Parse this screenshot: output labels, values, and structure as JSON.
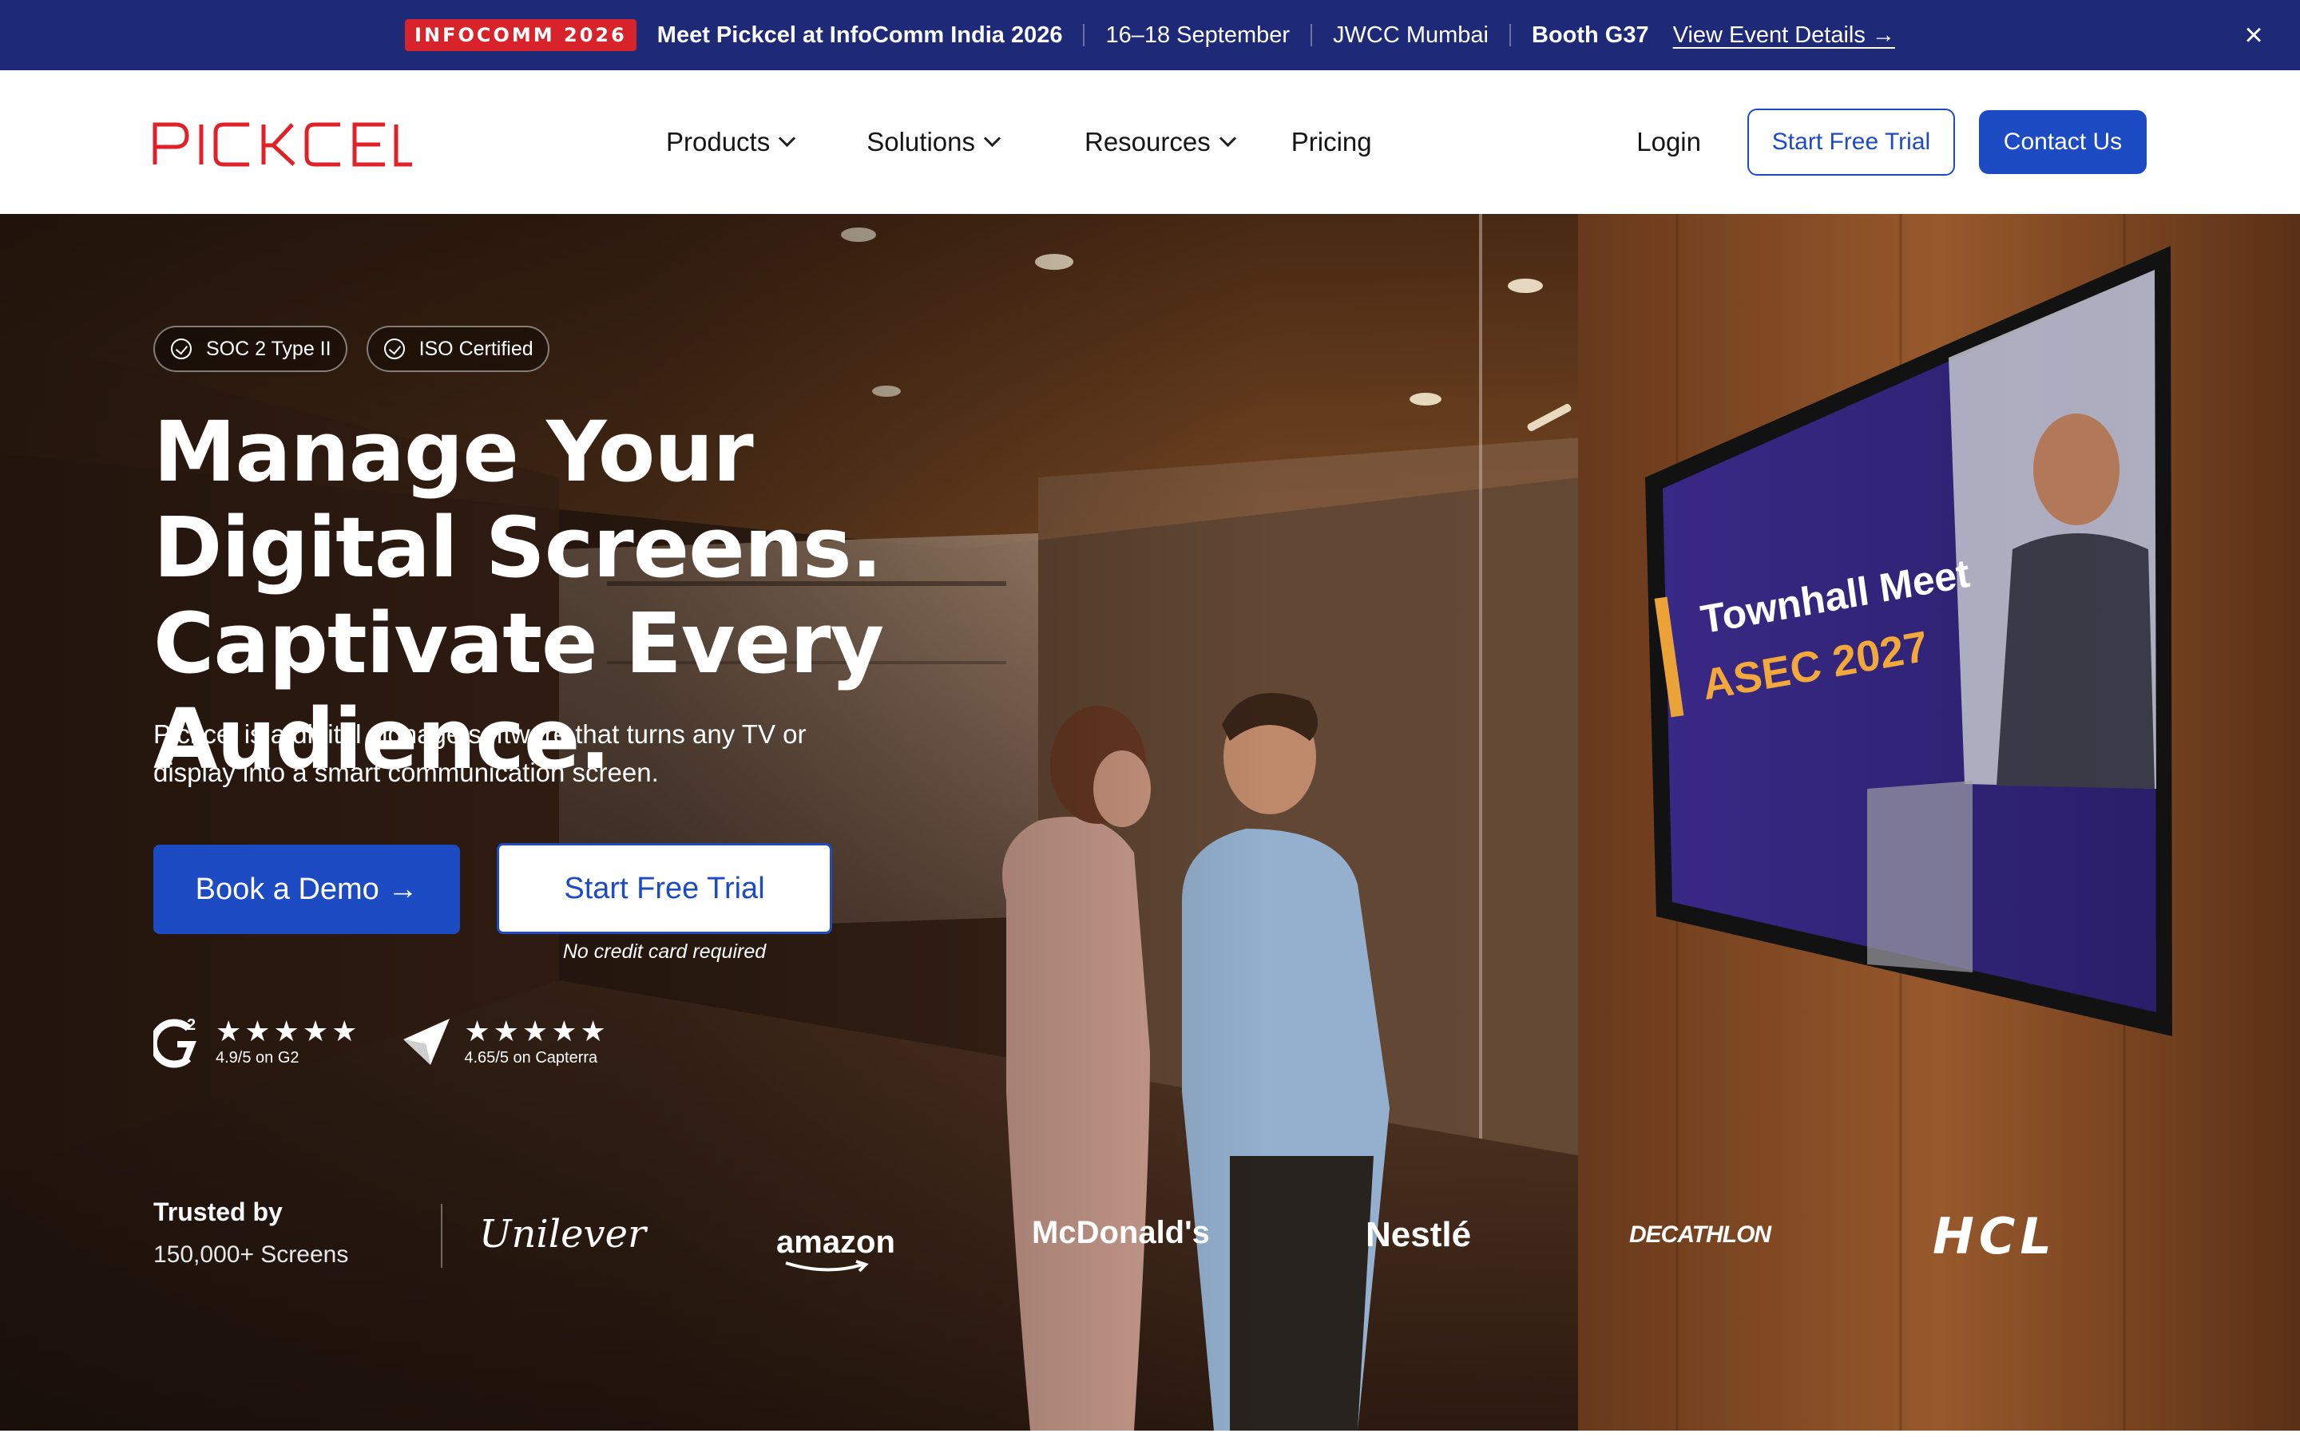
{
  "announcement": {
    "badge": "INFOCOMM 2026",
    "headline": "Meet Pickcel at InfoComm India 2026",
    "dates": "16–18 September",
    "venue": "JWCC Mumbai",
    "booth": "Booth G37",
    "link": "View Event Details →",
    "close": "×"
  },
  "nav": {
    "logo": "PICKCEL",
    "items": [
      {
        "label": "Products"
      },
      {
        "label": "Solutions"
      },
      {
        "label": "Resources"
      },
      {
        "label": "Pricing"
      }
    ],
    "login": "Login",
    "trial": "Start Free Trial",
    "contact": "Contact Us"
  },
  "hero": {
    "badges": [
      "SOC 2 Type II",
      "ISO Certified"
    ],
    "title": "Manage Your Digital Screens. Captivate Every Audience.",
    "subtitle": "Pickcel is a digital signage software that turns any TV or display into a smart communication screen.",
    "cta_demo": "Book a Demo →",
    "cta_trial": "Start Free Trial",
    "no_cc": "No credit card required",
    "ratings": [
      {
        "stars": "★★★★★",
        "value": 4.9,
        "text": "4.9/5 on G2",
        "icon": "g2-logo-icon"
      },
      {
        "stars": "★★★★★",
        "value": 4.65,
        "text": "4.65/5 on Capterra",
        "icon": "capterra-logo-icon"
      }
    ],
    "trusted_title": "Trusted by",
    "trusted_sub": "150,000+ Screens",
    "brands": [
      "Unilever",
      "amazon",
      "McDonald's",
      "Nestlé",
      "DECATHLON",
      "HCL"
    ],
    "tv": {
      "title": "Townhall Meet",
      "subtitle": "ASEC 2027"
    }
  },
  "colors": {
    "announce_bg": "#1e2a78",
    "badge_red": "#d8232a",
    "primary_blue": "#1d4bc4",
    "logo_red": "#e02128"
  }
}
